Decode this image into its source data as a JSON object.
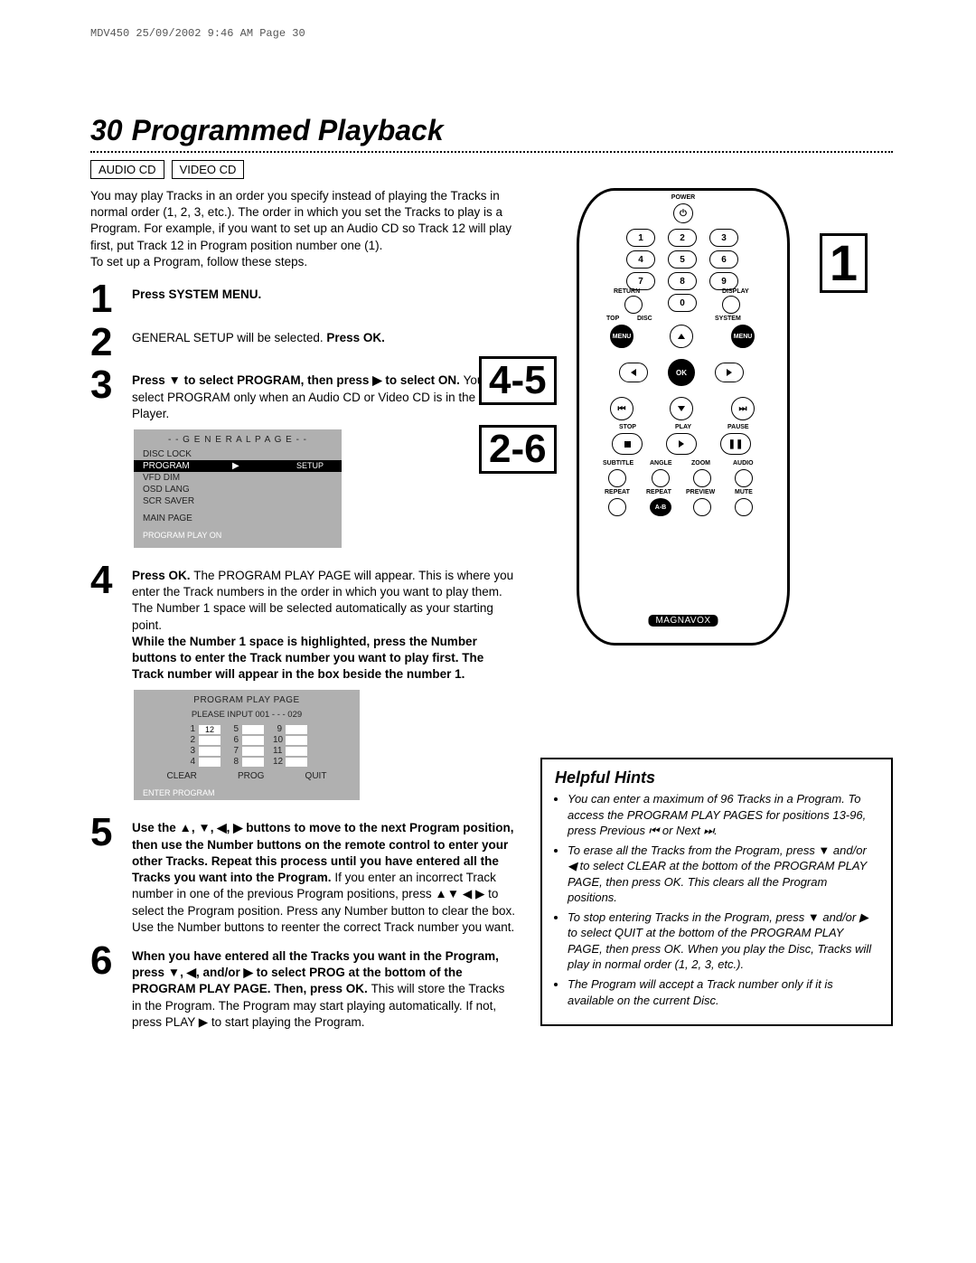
{
  "printHeader": "MDV450  25/09/2002  9:46 AM  Page 30",
  "pageNumber": "30",
  "title": "Programmed Playback",
  "tags": [
    "AUDIO CD",
    "VIDEO CD"
  ],
  "intro": "You may play Tracks in an order you specify instead of playing the Tracks in normal order (1, 2, 3, etc.). The order in which you set the Tracks to play is a Program. For example, if you want to set up an Audio CD so Track 12 will play first, put Track 12 in Program position number one (1).",
  "introFollow": "To set up a Program, follow these steps.",
  "steps": {
    "s1": {
      "num": "1",
      "bold": "Press SYSTEM MENU."
    },
    "s2": {
      "num": "2",
      "text": "GENERAL SETUP will be selected. ",
      "bold": "Press OK."
    },
    "s3": {
      "num": "3",
      "bold": "Press ▼ to select PROGRAM, then press ▶ to select ON. ",
      "text": "You can select PROGRAM only when an Audio CD or Video CD is in the DVD Player."
    },
    "s4": {
      "num": "4",
      "bold1": "Press OK. ",
      "text1": "The PROGRAM PLAY PAGE will appear. This is where you enter the Track numbers in the order in which you want to play them. The Number 1 space will be selected automatically as your starting point.",
      "bold2": "While the Number 1 space is highlighted, press the Number buttons to enter the Track number you want to play first. The Track number will appear in the box beside the number 1."
    },
    "s5": {
      "num": "5",
      "bold": "Use the ▲, ▼, ◀, ▶ buttons to move to the next Program position, then use the Number buttons on the remote control to enter your other Tracks. Repeat this process until you have entered all the Tracks you want into the Program.",
      "text": "If you enter an incorrect Track number in one of the previous Program positions, press ▲▼ ◀ ▶ to select the Program position. Press any Number button to clear the box. Use the Number buttons to reenter the correct Track number you want."
    },
    "s6": {
      "num": "6",
      "bold": "When you have entered all the Tracks you want in the Program, press ▼, ◀, and/or ▶ to select PROG at the bottom of the PROGRAM PLAY PAGE. Then, press OK. ",
      "text": "This will store the Tracks in the Program. The Program may start playing automatically. If not, press PLAY ▶ to start playing the Program."
    }
  },
  "osd1": {
    "head": "- -   G E N E R A L   P A G E   - -",
    "items": [
      "DISC LOCK",
      "PROGRAM",
      "VFD DIM",
      "OSD LANG",
      "SCR SAVER"
    ],
    "setup": "SETUP",
    "main": "MAIN PAGE",
    "foot": "PROGRAM PLAY ON"
  },
  "osd2": {
    "head": "PROGRAM PLAY PAGE",
    "sub": "PLEASE INPUT 001 - - - 029",
    "col1": [
      "1",
      "2",
      "3",
      "4"
    ],
    "col1v": [
      "12",
      "",
      "",
      ""
    ],
    "col2": [
      "5",
      "6",
      "7",
      "8"
    ],
    "col3": [
      "9",
      "10",
      "11",
      "12"
    ],
    "buttons": [
      "CLEAR",
      "PROG",
      "QUIT"
    ],
    "foot": "ENTER PROGRAM"
  },
  "hints": {
    "title": "Helpful Hints",
    "items": [
      "You can enter a maximum of 96 Tracks in a Program. To access the PROGRAM PLAY PAGES for positions 13-96, press Previous ⏮ or Next ⏭.",
      "To erase all the Tracks from the Program, press ▼ and/or ◀ to select CLEAR at the bottom of the PROGRAM PLAY PAGE, then press OK. This clears all the Program positions.",
      "To stop entering Tracks in the Program, press ▼ and/or ▶ to select QUIT at the bottom of the PROGRAM PLAY PAGE, then press OK. When you play the Disc, Tracks will play in normal order (1, 2, 3, etc.).",
      "The Program will accept a Track number only if it is available on the current Disc."
    ]
  },
  "callouts": {
    "c1": "1",
    "c45": "4-5",
    "c26": "2-6"
  },
  "remote": {
    "power": "POWER",
    "nums": [
      "1",
      "2",
      "3",
      "4",
      "5",
      "6",
      "7",
      "8",
      "9",
      "0"
    ],
    "return": "RETURN",
    "display": "DISPLAY",
    "top": "TOP",
    "disc": "DISC",
    "menu": "MENU",
    "system": "SYSTEM",
    "ok": "OK",
    "stop": "STOP",
    "play": "PLAY",
    "pause": "PAUSE",
    "row1": [
      "SUBTITLE",
      "ANGLE",
      "ZOOM",
      "AUDIO"
    ],
    "row2": [
      "REPEAT",
      "REPEAT",
      "PREVIEW",
      "MUTE"
    ],
    "ab": "A-B",
    "brand": "MAGNAVOX"
  }
}
